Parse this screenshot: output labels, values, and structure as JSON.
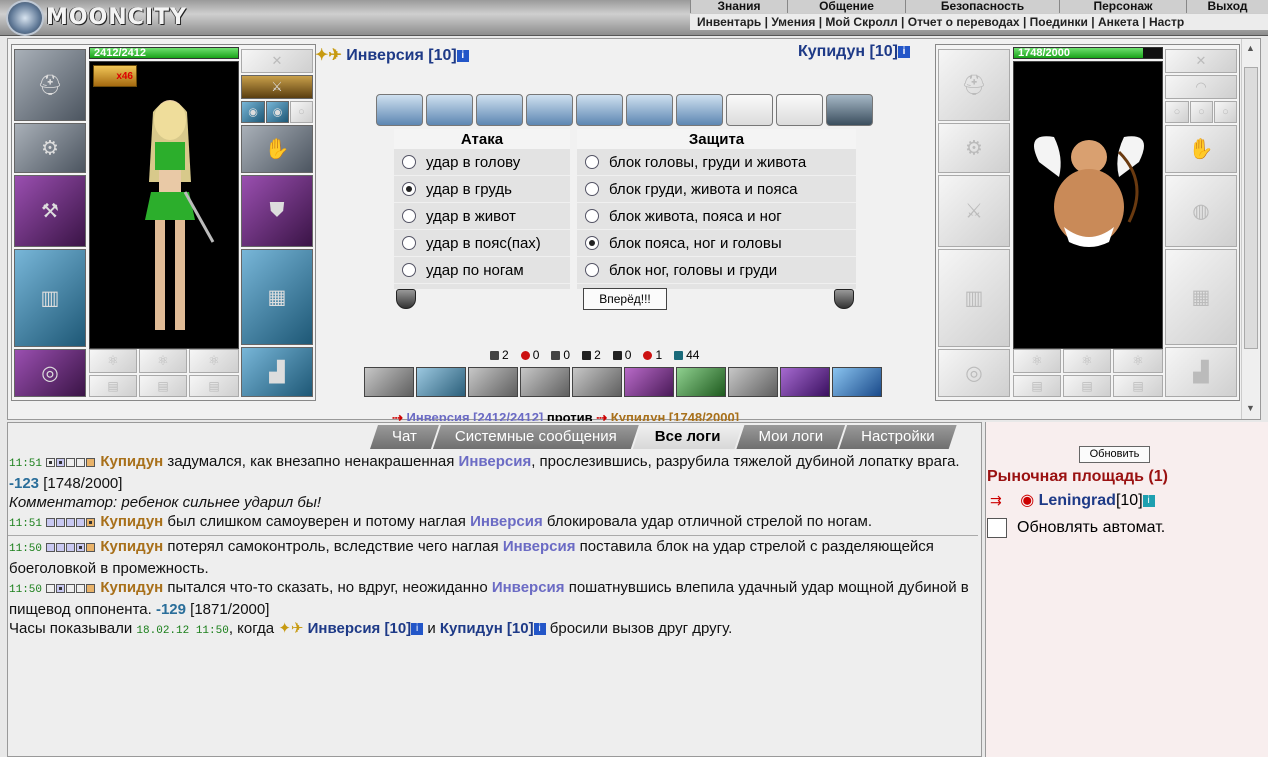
{
  "brand": {
    "name": "MOONCITY"
  },
  "top_menu": [
    "Знания",
    "Общение",
    "Безопасность",
    "Персонаж",
    "Выход"
  ],
  "sub_menu": [
    "Инвентарь",
    "Умения",
    "Мой Скролл",
    "Отчет о переводах",
    "Поединки",
    "Анкета",
    "Настр"
  ],
  "player": {
    "name": "Инверсия",
    "level": "[10]",
    "hp": "2412/2412",
    "hp_fraction": 1.0,
    "badge": "x46"
  },
  "opponent": {
    "name": "Купидун",
    "level": "[10]",
    "hp": "1748/2000",
    "hp_fraction": 0.874
  },
  "attack": {
    "title": "Атака",
    "options": [
      "удар в голову",
      "удар в грудь",
      "удар в живот",
      "удар в пояс(пах)",
      "удар по ногам"
    ],
    "selected": 1
  },
  "defense": {
    "title": "Защита",
    "options": [
      "блок головы, груди и живота",
      "блок груди, живота и пояса",
      "блок живота, пояса и ног",
      "блок пояса, ног и головы",
      "блок ног, головы и груди"
    ],
    "selected": 3
  },
  "go_button": "Вперёд!!!",
  "stats": [
    {
      "icon": "sword-icon",
      "value": "2",
      "color": "#444444"
    },
    {
      "icon": "blood-drop-icon",
      "value": "0",
      "color": "#cc1111"
    },
    {
      "icon": "swirl-icon",
      "value": "0",
      "color": "#444444"
    },
    {
      "icon": "shield-icon",
      "value": "2",
      "color": "#222222"
    },
    {
      "icon": "cross-icon",
      "value": "0",
      "color": "#222222"
    },
    {
      "icon": "heart-icon",
      "value": "1",
      "color": "#cc1111"
    },
    {
      "icon": "defense-icon",
      "value": "44",
      "color": "#1a6a7a"
    }
  ],
  "vs_line": {
    "left": "Инверсия [2412/2412]",
    "middle": "против",
    "right": "Купидун [1748/2000]"
  },
  "tabs": [
    "Чат",
    "Системные сообщения",
    "Все логи",
    "Мои логи",
    "Настройки"
  ],
  "active_tab": 2,
  "log": [
    {
      "time": "11:51",
      "actor": "Купидун",
      "text_a": " задумался, как внезапно ненакрашенная ",
      "other": "Инверсия",
      "text_b": ", прослезившись, разрубила тяжелой дубиной лопатку врага. ",
      "dmg": "-123",
      "hp": " [1748/2000]"
    },
    {
      "comment": "Комментатор: ребенок сильнее ударил бы!"
    },
    {
      "time": "11:51",
      "actor": "Купидун",
      "text_a": " был слишком самоуверен и потому наглая ",
      "other": "Инверсия",
      "text_b": " блокировала удар отличной стрелой по ногам.",
      "dmg": "",
      "hp": ""
    },
    {
      "time": "11:50",
      "actor": "Купидун",
      "text_a": " потерял самоконтроль, вследствие чего наглая ",
      "other": "Инверсия",
      "text_b": " поставила блок на удар стрелой с разделяющейся боеголовкой в промежность.",
      "dmg": "",
      "hp": ""
    },
    {
      "time": "11:50",
      "actor": "Купидун",
      "text_a": " пытался что-то сказать, но вдруг, неожиданно ",
      "other": "Инверсия",
      "text_b": " пошатнувшись влепила удачный удар мощной дубиной в пищевод оппонента. ",
      "dmg": "-129",
      "hp": " [1871/2000]"
    }
  ],
  "final_line": {
    "a": "Часы показывали ",
    "date": "18.02.12 11:50",
    "b": ", когда ",
    "p1": "Инверсия [10]",
    "and": " и ",
    "p2": "Купидун [10]",
    "c": " бросили вызов друг другу."
  },
  "sidebar": {
    "refresh": "Обновить",
    "market": "Рыночная площадь (1)",
    "user": "Leningrad",
    "user_level": "[10]",
    "auto": "Обновлять автомат."
  }
}
